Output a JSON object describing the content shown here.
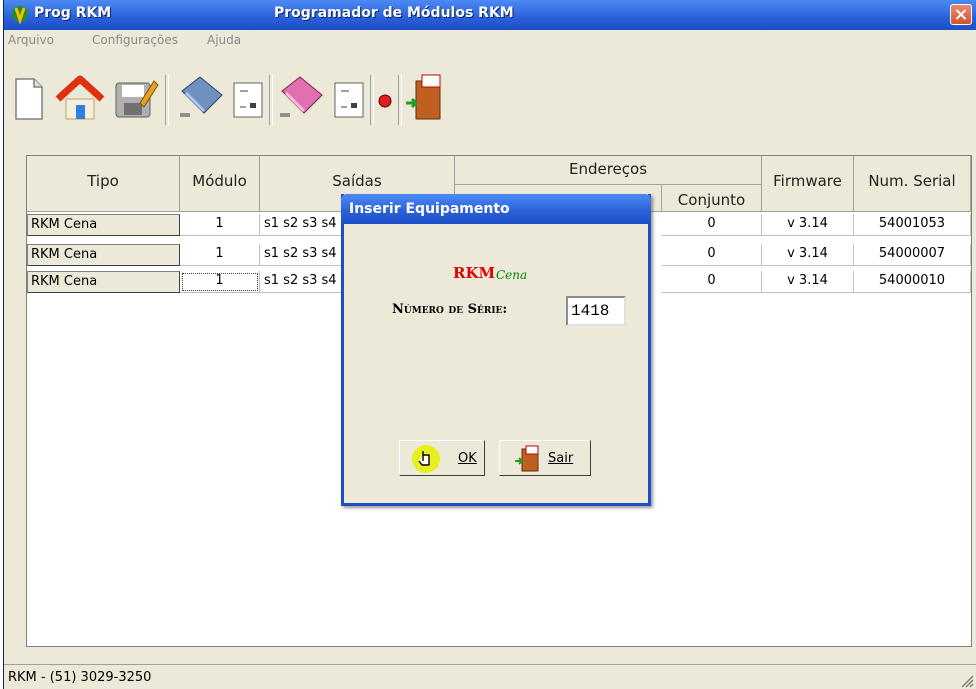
{
  "window": {
    "app_name": "Prog RKM",
    "title": "Programador de Módulos RKM"
  },
  "menu": [
    "Arquivo",
    "Configurações",
    "Ajuda"
  ],
  "toolbar": [
    {
      "icon": "new-file-icon"
    },
    {
      "icon": "home-icon"
    },
    {
      "icon": "save-icon"
    },
    {
      "icon": "scan-module-icon"
    },
    {
      "icon": "module-list-icon"
    },
    {
      "icon": "erase-module-icon"
    },
    {
      "icon": "module-list-icon"
    },
    {
      "icon": "record-icon"
    },
    {
      "icon": "exit-door-icon"
    }
  ],
  "grid": {
    "headers": {
      "tipo": "Tipo",
      "modulo": "Módulo",
      "saidas": "Saídas",
      "enderecos": "Endereços",
      "conjunto": "Conjunto",
      "firmware": "Firmware",
      "serial": "Num. Serial"
    },
    "rows": [
      {
        "tipo": "RKM Cena",
        "modulo": "1",
        "saidas": "s1 s2 s3 s4",
        "conjunto": "0",
        "firmware": "v 3.14",
        "serial": "54001053"
      },
      {
        "tipo": "RKM Cena",
        "modulo": "1",
        "saidas": "s1 s2 s3 s4",
        "conjunto": "0",
        "firmware": "v 3.14",
        "serial": "54000007"
      },
      {
        "tipo": "RKM Cena",
        "modulo": "1",
        "saidas": "s1 s2 s3 s4",
        "conjunto": "0",
        "firmware": "v 3.14",
        "serial": "54000010"
      }
    ]
  },
  "status": "RKM - (51) 3029-3250",
  "dialog": {
    "title": "Inserir Equipamento",
    "logo_main": "RKM",
    "logo_sub": "Cena",
    "serie_label": "Número de Série:",
    "serie_value": "1418",
    "ok_label": "OK",
    "sair_label": "Sair"
  },
  "colors": {
    "titlebar": "#2A5FD8",
    "window_bg": "#ECE9D8",
    "logo_red": "#E00000",
    "logo_green": "#008800",
    "cursor_highlight": "#E8F000"
  }
}
